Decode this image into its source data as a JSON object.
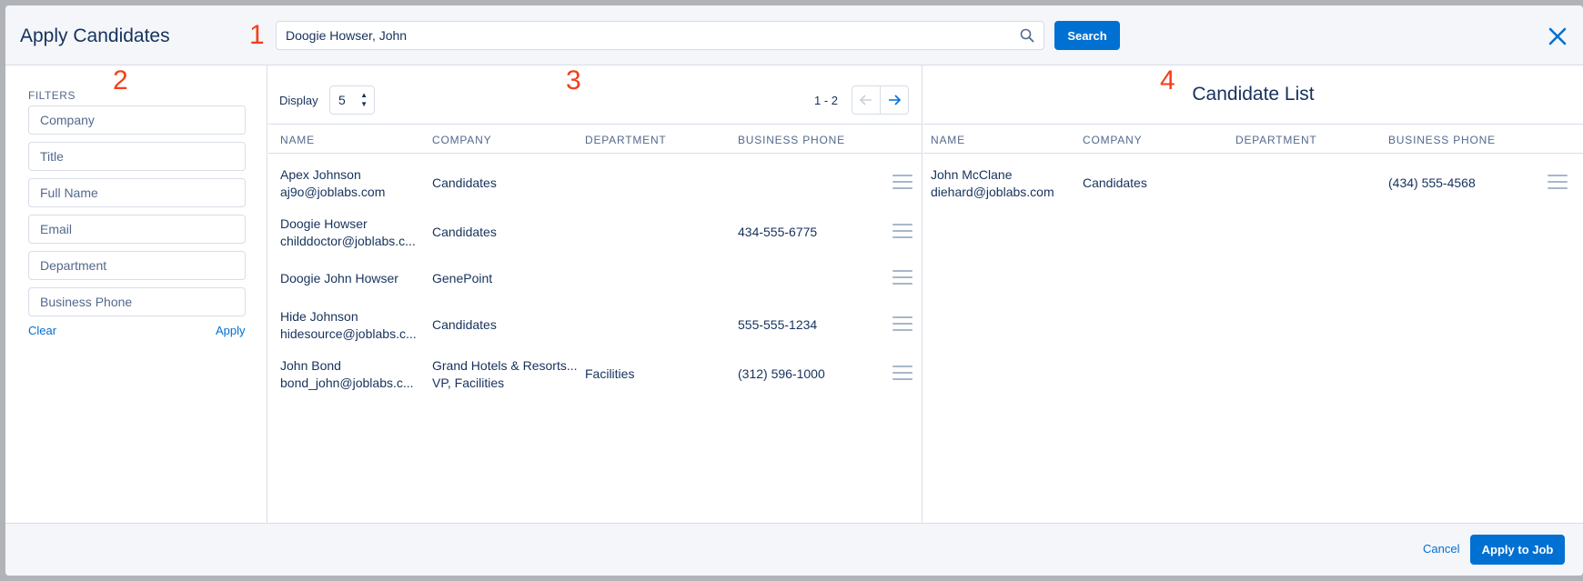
{
  "header": {
    "title": "Apply Candidates",
    "search_value": "Doogie Howser, John",
    "search_button": "Search"
  },
  "annotations": [
    "1",
    "2",
    "3",
    "4"
  ],
  "filters": {
    "label": "FILTERS",
    "fields": [
      "Company",
      "Title",
      "Full Name",
      "Email",
      "Department",
      "Business Phone"
    ],
    "clear": "Clear",
    "apply": "Apply"
  },
  "results": {
    "display_label": "Display",
    "display_value": "5",
    "page_info": "1 - 2",
    "columns": [
      "NAME",
      "COMPANY",
      "DEPARTMENT",
      "BUSINESS PHONE"
    ],
    "rows": [
      {
        "name": "Apex Johnson",
        "email": "aj9o@joblabs.com",
        "company": "Candidates",
        "company2": "",
        "department": "",
        "phone": ""
      },
      {
        "name": "Doogie Howser",
        "email": "childdoctor@joblabs.c...",
        "company": "Candidates",
        "company2": "",
        "department": "",
        "phone": "434-555-6775"
      },
      {
        "name": "Doogie John Howser",
        "email": "",
        "company": "GenePoint",
        "company2": "",
        "department": "",
        "phone": ""
      },
      {
        "name": "Hide Johnson",
        "email": "hidesource@joblabs.c...",
        "company": "Candidates",
        "company2": "",
        "department": "",
        "phone": "555-555-1234"
      },
      {
        "name": "John Bond",
        "email": "bond_john@joblabs.c...",
        "company": "Grand Hotels & Resorts...",
        "company2": "VP, Facilities",
        "department": "Facilities",
        "phone": "(312) 596-1000"
      }
    ]
  },
  "candidate_list": {
    "title": "Candidate List",
    "columns": [
      "NAME",
      "COMPANY",
      "DEPARTMENT",
      "BUSINESS PHONE"
    ],
    "rows": [
      {
        "name": "John McClane",
        "email": "diehard@joblabs.com",
        "company": "Candidates",
        "department": "",
        "phone": "(434) 555-4568"
      }
    ]
  },
  "footer": {
    "cancel": "Cancel",
    "apply_to_job": "Apply to Job"
  },
  "colors": {
    "brand": "#0070d2",
    "annotation": "#f43e1b",
    "text": "#16325c"
  }
}
